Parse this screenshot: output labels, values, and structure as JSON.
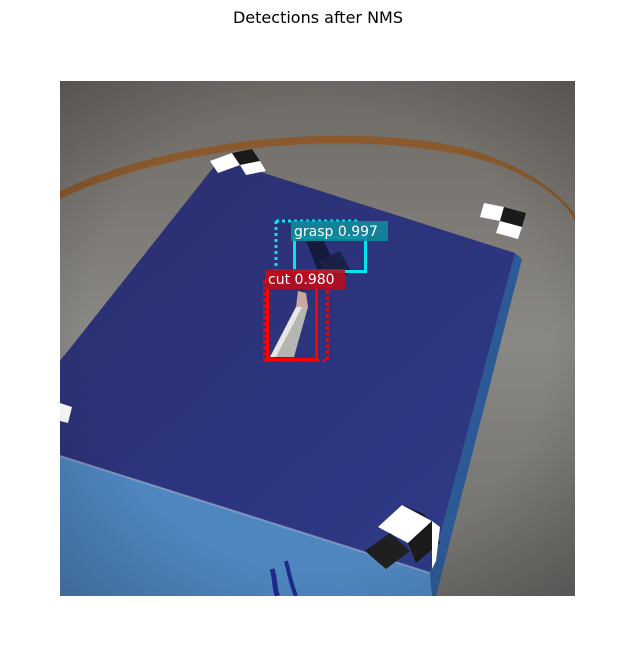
{
  "figure": {
    "title": "Detections after NMS"
  },
  "colors": {
    "background_wall": "#777470",
    "table_ring": "#8a5a2e",
    "board_top": "#2b3478",
    "board_side": "#3f6fb0",
    "cut_box": "#ff0000",
    "cut_label_bg": "#b80d1e",
    "grasp_box": "#00e5f0",
    "grasp_label_bg": "#118a9a"
  },
  "detections": [
    {
      "class": "grasp",
      "score": "0.997",
      "label": "grasp 0.997"
    },
    {
      "class": "cut",
      "score": "0.980",
      "label": "cut 0.980"
    }
  ]
}
